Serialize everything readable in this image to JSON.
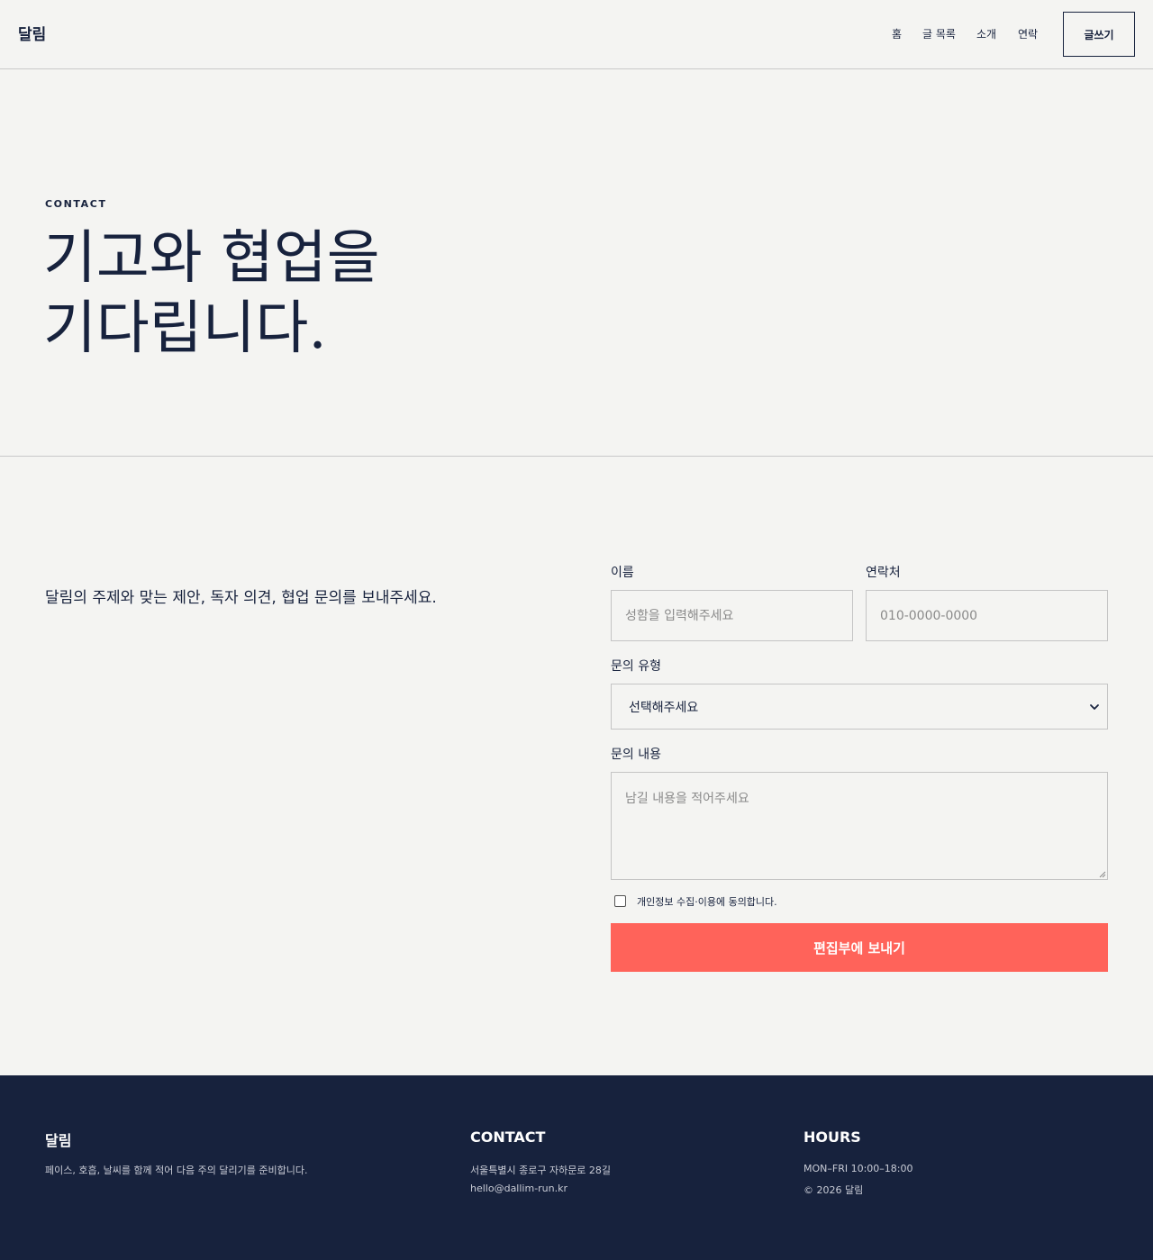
{
  "header": {
    "logo": "달림",
    "nav": [
      "홈",
      "글 목록",
      "소개",
      "연락"
    ],
    "write_button": "글쓰기"
  },
  "hero": {
    "eyebrow": "CONTACT",
    "title_line1": "기고와 협업을",
    "title_line2": "기다립니다."
  },
  "form": {
    "intro": "달림의 주제와 맞는 제안, 독자 의견, 협업 문의를 보내주세요.",
    "name_label": "이름",
    "name_placeholder": "성함을 입력해주세요",
    "phone_label": "연락처",
    "phone_placeholder": "010-0000-0000",
    "type_label": "문의 유형",
    "type_selected": "선택해주세요",
    "message_label": "문의 내용",
    "message_placeholder": "남길 내용을 적어주세요",
    "consent_text": "개인정보 수집·이용에 동의합니다.",
    "consent_checked": false,
    "submit_label": "편집부에 보내기"
  },
  "footer": {
    "brand": "달림",
    "brand_desc": "페이스, 호흡, 날씨를 함께 적어 다음 주의 달리기를 준비합니다.",
    "contact_heading": "CONTACT",
    "address": "서울특별시 종로구 자하문로 28길",
    "email": "hello@dallim-run.kr",
    "hours_heading": "HOURS",
    "hours": "MON–FRI 10:00–18:00",
    "copyright": "© 2026 달림"
  },
  "colors": {
    "background": "#f4f4f2",
    "navy": "#17223d",
    "accent": "#ff635a",
    "border": "#c4c4c4"
  },
  "icons": {
    "select_arrow": "chevron-down-icon",
    "textarea_grip": "resize-grip-icon"
  }
}
